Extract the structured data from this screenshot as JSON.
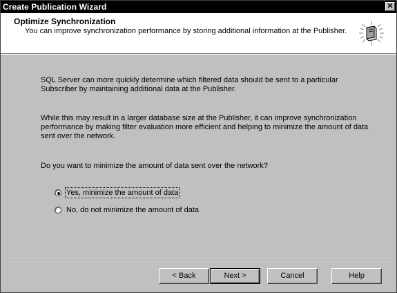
{
  "window": {
    "title": "Create Publication Wizard",
    "close_glyph": "✕"
  },
  "header": {
    "title": "Optimize Synchronization",
    "description": "You can improve synchronization performance by storing additional information at the Publisher.",
    "icon": "wizard-book-icon"
  },
  "content": {
    "paragraph1": "SQL Server can more quickly determine which filtered data should be sent to a particular Subscriber by maintaining additional data at the Publisher.",
    "paragraph2": "While this may result in a larger database size at the Publisher, it can improve synchronization performance by making filter evaluation more efficient and helping to minimize the amount of data sent over the network.",
    "question": "Do you want to minimize the amount of data sent over the network?",
    "options": [
      {
        "label": "Yes, minimize the amount of data",
        "selected": true
      },
      {
        "label": "No, do not minimize the amount of data",
        "selected": false
      }
    ]
  },
  "buttons": {
    "back": "< Back",
    "next": "Next >",
    "cancel": "Cancel",
    "help": "Help"
  }
}
